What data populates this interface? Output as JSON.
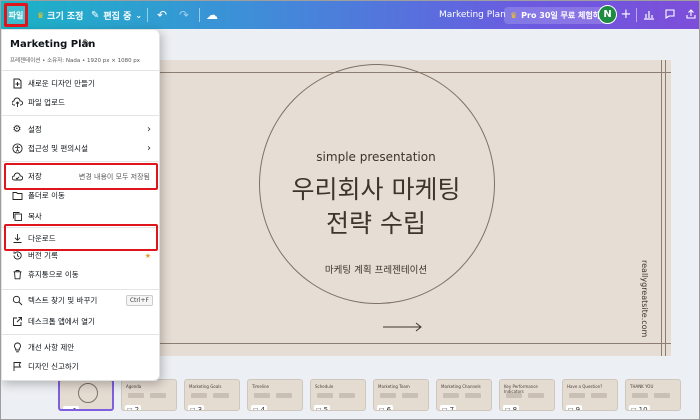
{
  "toolbar": {
    "file_label": "파일",
    "resize_label": "크기 조정",
    "edit_mode_label": "편집 중",
    "doc_title": "Marketing Plan",
    "pro_trial_label": "Pro 30일 무료 체험하기",
    "avatar_initial": "N",
    "gradient_colors": [
      "#1ab4c6",
      "#3d8fd8",
      "#6a5be0",
      "#7d4ed9"
    ]
  },
  "menu": {
    "title": "Marketing Plan",
    "meta": "프레젠테이션 • 소유자: Nada • 1920 px × 1080 px",
    "items": [
      {
        "icon": "add-file-icon",
        "label": "새로운 디자인 만들기"
      },
      {
        "icon": "cloud-upload-icon",
        "label": "파일 업로드"
      },
      {
        "icon": "gear-icon",
        "label": "설정"
      },
      {
        "icon": "accessibility-icon",
        "label": "접근성 및 편의시설"
      },
      {
        "icon": "cloud-save-icon",
        "label": "저장",
        "status": "변경 내용이 모두 저장됨"
      },
      {
        "icon": "folder-icon",
        "label": "폴더로 이동"
      },
      {
        "icon": "copy-icon",
        "label": "복사"
      },
      {
        "icon": "download-icon",
        "label": "다운로드"
      },
      {
        "icon": "history-icon",
        "label": "버전 기록"
      },
      {
        "icon": "trash-icon",
        "label": "휴지통으로 이동"
      },
      {
        "icon": "search-replace-icon",
        "label": "텍스트 찾기 및 바꾸기",
        "shortcut": "Ctrl+F"
      },
      {
        "icon": "external-link-icon",
        "label": "데스크톱 앱에서 열기"
      },
      {
        "icon": "lightbulb-icon",
        "label": "개선 사항 제안"
      },
      {
        "icon": "flag-icon",
        "label": "디자인 신고하기"
      }
    ]
  },
  "slide": {
    "subtitle": "simple presentation",
    "title_line1": "우리회사 마케팅",
    "title_line2": "전략 수립",
    "description": "마케팅 계획 프레젠테이션",
    "website": "reallygreatsite.com",
    "background": "#e6ddd4"
  },
  "filmstrip": {
    "pages": [
      {
        "number": "1",
        "title": ""
      },
      {
        "number": "2",
        "title": "Agenda"
      },
      {
        "number": "3",
        "title": "Marketing Goals"
      },
      {
        "number": "4",
        "title": "Timeline"
      },
      {
        "number": "5",
        "title": "Schedule"
      },
      {
        "number": "6",
        "title": "Marketing Team"
      },
      {
        "number": "7",
        "title": "Marketing Channels"
      },
      {
        "number": "8",
        "title": "Key Performance Indicators"
      },
      {
        "number": "9",
        "title": "Have a Question?"
      },
      {
        "number": "10",
        "title": "THANK YOU"
      }
    ]
  }
}
